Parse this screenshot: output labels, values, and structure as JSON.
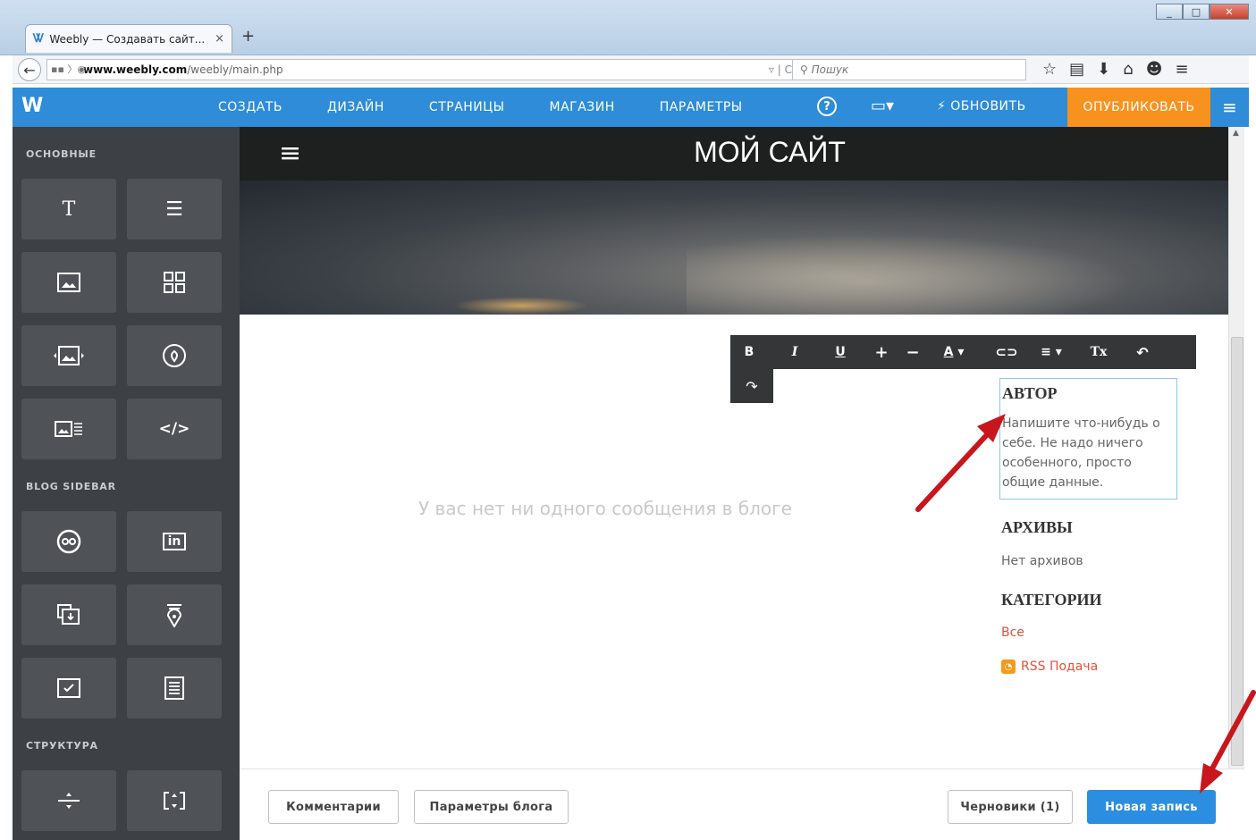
{
  "browser": {
    "tab_title": "Weebly — Создавать сайт...",
    "tab_close": "×",
    "new_tab": "+",
    "url_host": "www.weebly.com",
    "url_path": "/weebly/main.php",
    "search_placeholder": "Пошук"
  },
  "weebly_bar": {
    "logo": "W",
    "menu": [
      "СОЗДАТЬ",
      "ДИЗАЙН",
      "СТРАНИЦЫ",
      "МАГАЗИН",
      "ПАРАМЕТРЫ"
    ],
    "help": "?",
    "update_label": "ОБНОВИТЬ",
    "publish_label": "ОПУБЛИКОВАТЬ"
  },
  "sidebar": {
    "section_basic": "ОСНОВНЫЕ",
    "section_blog": "BLOG SIDEBAR",
    "section_structure": "СТРУКТУРА",
    "tiles": {
      "title": "T",
      "code": "</>",
      "social": "in"
    }
  },
  "site": {
    "title": "МОЙ САЙТ",
    "empty_message": "У вас нет ни одного сообщения в блоге"
  },
  "format_toolbar": {
    "bold": "B",
    "italic": "I",
    "underline": "U",
    "plus": "+",
    "minus": "−",
    "font_color": "A",
    "clear": "Tx"
  },
  "blog_sidebar": {
    "author_title": "АВТОР",
    "author_text": "Напишите что-нибудь о себе. Не надо ничего особенного, просто общие данные.",
    "archives_title": "АРХИВЫ",
    "archives_text": "Нет архивов",
    "categories_title": "КАТЕГОРИИ",
    "categories_all": "Все",
    "rss_label": "RSS Подача"
  },
  "bottom_bar": {
    "comments": "Комментарии",
    "blog_settings": "Параметры блога",
    "drafts": "Черновики (1)",
    "new_post": "Новая запись"
  },
  "colors": {
    "accent": "#2e8cd8",
    "publish": "#f7921e",
    "sidebar_bg": "#3d4045",
    "link": "#e3513a",
    "annotation_arrow": "#c8161d"
  }
}
